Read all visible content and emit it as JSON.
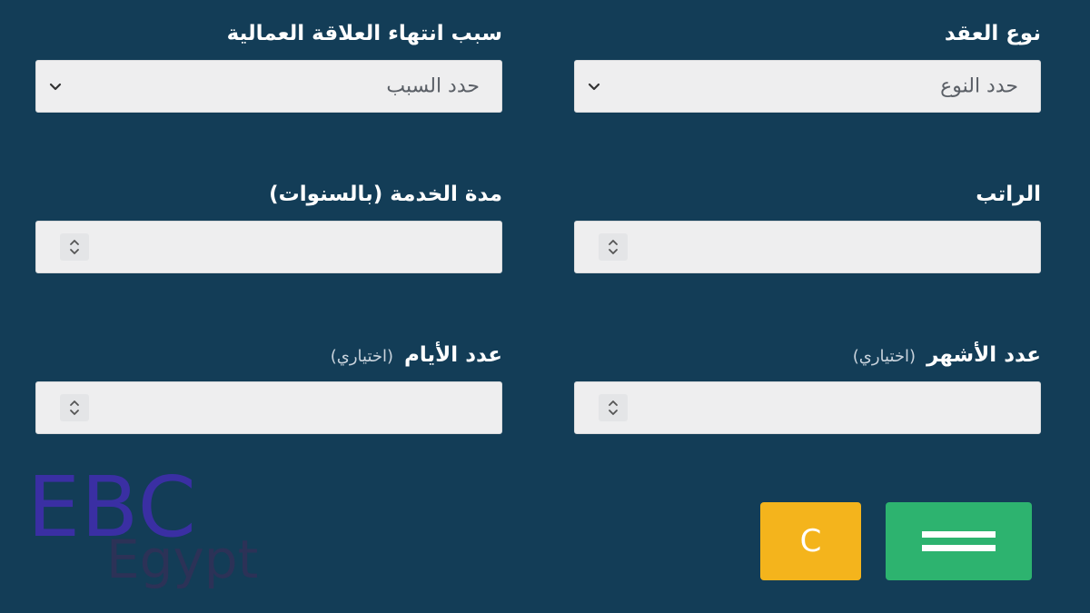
{
  "form": {
    "contract_type": {
      "label": "نوع العقد",
      "value": "حدد النوع"
    },
    "termination_reason": {
      "label": "سبب انتهاء العلاقة العمالية",
      "value": "حدد السبب"
    },
    "salary": {
      "label": "الراتب",
      "value": ""
    },
    "service_years": {
      "label": "مدة الخدمة (بالسنوات)",
      "value": ""
    },
    "months": {
      "label": "عدد الأشهر",
      "optional": "(اختياري)",
      "value": ""
    },
    "days": {
      "label": "عدد الأيام",
      "optional": "(اختياري)",
      "value": ""
    }
  },
  "actions": {
    "clear_label": "C"
  },
  "watermark": {
    "line1": "EBC",
    "line2": "Egypt"
  },
  "colors": {
    "background": "#133d57",
    "clear_button": "#f4b41c",
    "calculate_button": "#2db36f",
    "field_bg": "#eeeeef"
  },
  "icons": {
    "select": "chevron-down-icon",
    "number": "spinner-arrows-icon",
    "calculate": "equals-icon"
  }
}
